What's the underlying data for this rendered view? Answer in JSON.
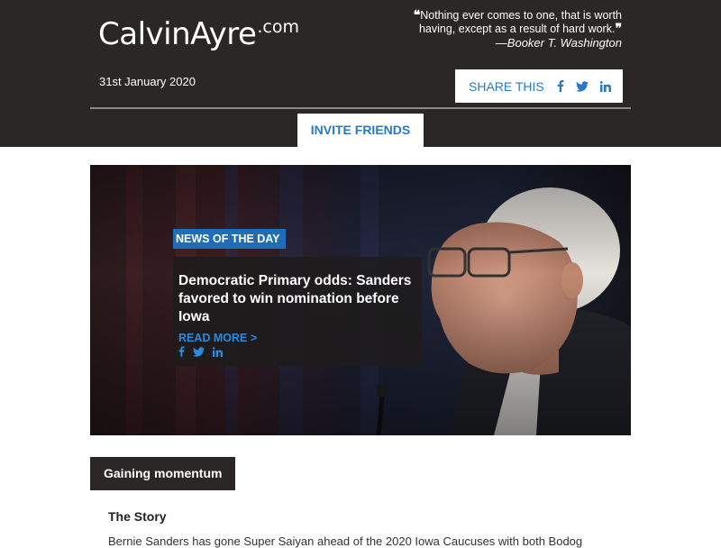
{
  "header": {
    "logo": "CalvinAyre",
    "logo_tld": ".com",
    "quote_text": "Nothing ever comes to one, that is worth having, except as a result of hard work.",
    "quote_author": "—Booker T. Washington",
    "date": "31st January 2020",
    "share_label": "SHARE THIS",
    "invite_label": "INVITE FRIENDS"
  },
  "hero": {
    "badge": "NEWS OF THE DAY",
    "headline": "Democratic Primary odds: Sanders favored to win nomination before Iowa",
    "read_more": "READ MORE >"
  },
  "section": {
    "tab_label": "Gaining momentum",
    "story_heading": "The Story",
    "story_text_start": "Bernie Sanders has gone Super Saiyan ahead of the 2020 Iowa Caucuses with both Bodog"
  },
  "colors": {
    "header_bg": "#2b2727",
    "accent_blue": "#2a79c2",
    "badge_blue": "#1f6db6"
  },
  "icons": [
    "facebook-icon",
    "twitter-icon",
    "linkedin-icon",
    "open-quote-icon",
    "close-quote-icon"
  ]
}
